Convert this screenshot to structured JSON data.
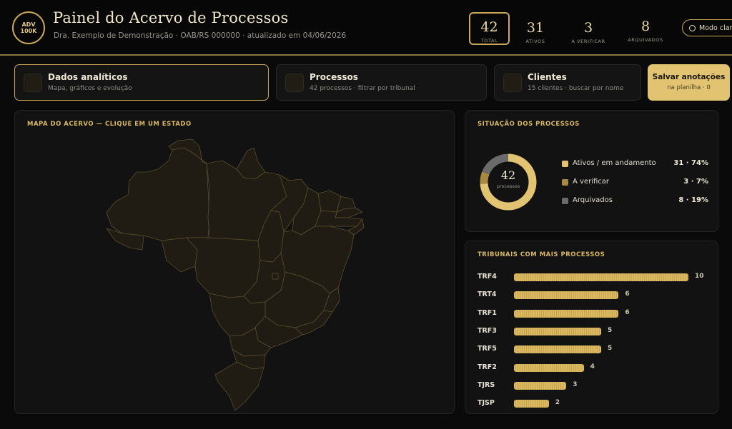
{
  "header": {
    "logo_line1": "ADV",
    "logo_line2": "100K",
    "title": "Painel do Acervo de Processos",
    "subtitle": "Dra. Exemplo de Demonstração · OAB/RS 000000 · atualizado em 04/06/2026",
    "mode_button": "Modo claro"
  },
  "stats": [
    {
      "value": "42",
      "label": "TOTAL"
    },
    {
      "value": "31",
      "label": "ATIVOS"
    },
    {
      "value": "3",
      "label": "A VERIFICAR"
    },
    {
      "value": "8",
      "label": "ARQUIVADOS"
    }
  ],
  "tabs": [
    {
      "title": "Dados analíticos",
      "subtitle": "Mapa, gráficos e evolução"
    },
    {
      "title": "Processos",
      "subtitle": "42 processos · filtrar por tribunal"
    },
    {
      "title": "Clientes",
      "subtitle": "15 clientes · buscar por nome"
    }
  ],
  "save": {
    "title": "Salvar anotações",
    "subtitle": "na planilha · 0"
  },
  "map": {
    "title": "MAPA DO ACERVO — CLIQUE EM UM ESTADO"
  },
  "status": {
    "title": "SITUAÇÃO DOS PROCESSOS",
    "total": "42",
    "total_label": "processos",
    "items": [
      {
        "name": "Ativos / em andamento",
        "value": "31 · 74%",
        "count": 31,
        "color": "#e2c372"
      },
      {
        "name": "A verificar",
        "value": "3 · 7%",
        "count": 3,
        "color": "#a8893f"
      },
      {
        "name": "Arquivados",
        "value": "8 · 19%",
        "count": 8,
        "color": "#6b6b6b"
      }
    ]
  },
  "tribunais": {
    "title": "TRIBUNAIS COM MAIS PROCESSOS",
    "max": 10,
    "items": [
      {
        "code": "TRF4",
        "value": 10
      },
      {
        "code": "TRT4",
        "value": 6
      },
      {
        "code": "TRF1",
        "value": 6
      },
      {
        "code": "TRF3",
        "value": 5
      },
      {
        "code": "TRF5",
        "value": 5
      },
      {
        "code": "TRF2",
        "value": 4
      },
      {
        "code": "TJRS",
        "value": 3
      },
      {
        "code": "TJSP",
        "value": 2
      }
    ]
  }
}
